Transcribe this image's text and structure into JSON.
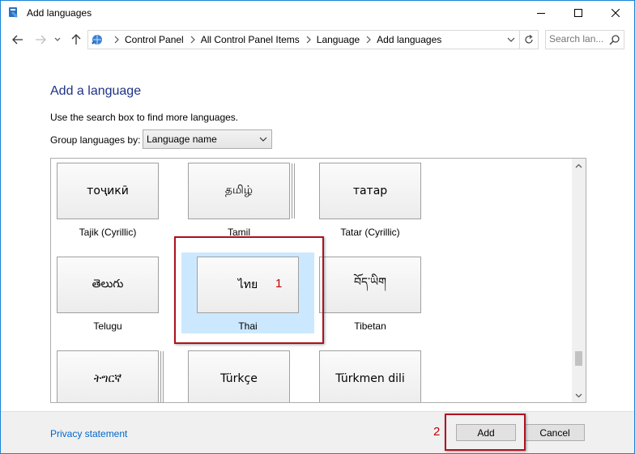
{
  "window": {
    "title": "Add languages",
    "controls": {
      "minimize": "minimize-icon",
      "maximize": "maximize-icon",
      "close": "close-icon"
    }
  },
  "address_bar": {
    "crumbs": [
      "Control Panel",
      "All Control Panel Items",
      "Language",
      "Add languages"
    ],
    "search_placeholder": "Search lan..."
  },
  "content": {
    "heading": "Add a language",
    "hint": "Use the search box to find more languages.",
    "group_label": "Group languages by:",
    "group_value": "Language name"
  },
  "languages": [
    {
      "native": "тоҷикӣ",
      "label": "Tajik (Cyrillic)"
    },
    {
      "native": "தமிழ்",
      "label": "Tamil"
    },
    {
      "native": "татар",
      "label": "Tatar (Cyrillic)"
    },
    {
      "native": "తెలుగు",
      "label": "Telugu"
    },
    {
      "native": "ไทย",
      "label": "Thai"
    },
    {
      "native": "བོད་ཡིག",
      "label": "Tibetan"
    },
    {
      "native": "ትግርኛ",
      "label": ""
    },
    {
      "native": "Türkçe",
      "label": ""
    },
    {
      "native": "Türkmen dili",
      "label": ""
    }
  ],
  "annotations": {
    "step1": "1",
    "step2": "2"
  },
  "footer": {
    "privacy": "Privacy statement",
    "add": "Add",
    "cancel": "Cancel"
  },
  "colors": {
    "accent": "#1883d7",
    "heading": "#1e3287",
    "link": "#0066cc",
    "highlight": "#b01020",
    "selection": "#cce8ff"
  }
}
